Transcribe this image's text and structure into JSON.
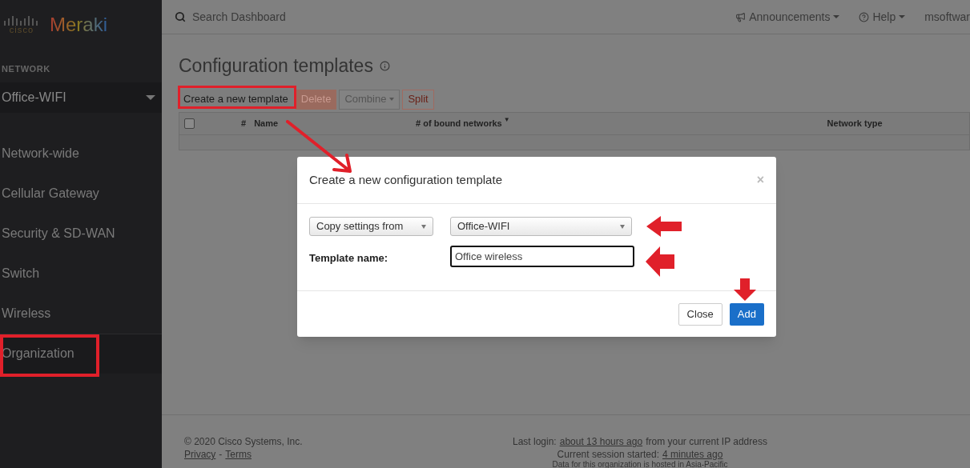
{
  "sidebar": {
    "logo": {
      "company": "cisco",
      "product": "Meraki"
    },
    "section_label": "NETWORK",
    "network_select": "Office-WIFI",
    "items": [
      {
        "label": "Network-wide",
        "selected": false
      },
      {
        "label": "Cellular Gateway",
        "selected": false
      },
      {
        "label": "Security & SD-WAN",
        "selected": false
      },
      {
        "label": "Switch",
        "selected": false
      },
      {
        "label": "Wireless",
        "selected": false
      },
      {
        "label": "Organization",
        "selected": true
      }
    ]
  },
  "topbar": {
    "search": {
      "placeholder": "Search Dashboard"
    },
    "menus": [
      {
        "label": "Announcements",
        "kind": "megaphone"
      },
      {
        "label": "Help",
        "kind": "help"
      }
    ],
    "user": "msoftwar"
  },
  "page": {
    "title": "Configuration templates",
    "toolbar": [
      {
        "label": "Create a new template",
        "kind": "default"
      },
      {
        "label": "Delete",
        "kind": "danger"
      },
      {
        "label": "Combine",
        "kind": "dropdown"
      },
      {
        "label": "Split",
        "kind": "danger-outline"
      }
    ],
    "table": {
      "checked": false,
      "columns": [
        {
          "label": "#",
          "sorted": false
        },
        {
          "label": "Name",
          "sorted": false
        },
        {
          "label": "# of bound networks",
          "sorted": true,
          "sort_mark": "▼"
        },
        {
          "label": "Network type",
          "sorted": false
        }
      ]
    }
  },
  "modal": {
    "title": "Create a new configuration template",
    "close": "×",
    "copy_select": "Copy settings from",
    "network_select": "Office-WIFI",
    "name_label": "Template name:",
    "name_value": "Office wireless",
    "buttons": [
      {
        "label": "Close",
        "kind": "default"
      },
      {
        "label": "Add",
        "kind": "primary"
      }
    ]
  },
  "footer": {
    "copyright": "© 2020 Cisco Systems, Inc.",
    "links": [
      "Privacy",
      "Terms"
    ],
    "separator": "-",
    "login": {
      "prefix": "Last login:",
      "link": "about 13 hours ago",
      "suffix": "from your current IP address"
    },
    "session": {
      "prefix": "Current session started:",
      "link": "4 minutes ago"
    },
    "hosting": "Data for this organization is hosted in Asia-Pacific"
  }
}
